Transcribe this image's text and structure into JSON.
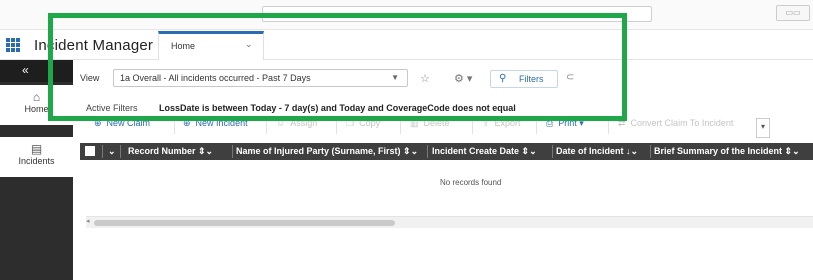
{
  "app": {
    "title": "Incident Manager"
  },
  "tabs": [
    {
      "label": "Home"
    }
  ],
  "sidebar": {
    "collapse_label": "«",
    "items": [
      {
        "label": "Home",
        "icon": "home-icon"
      },
      {
        "label": "Incidents",
        "icon": "document-icon"
      }
    ]
  },
  "view": {
    "label": "View",
    "selected": "1a Overall - All incidents occurred - Past 7 Days",
    "filters_label": "Filters"
  },
  "active_filters": {
    "label": "Active Filters",
    "value": "LossDate is between Today - 7 day(s) and Today and CoverageCode does not equal"
  },
  "toolbar": {
    "buttons": [
      {
        "label": "New Claim",
        "icon": "plus-circle-icon",
        "enabled": true
      },
      {
        "label": "New Incident",
        "icon": "plus-circle-icon",
        "enabled": true
      },
      {
        "label": "Assign",
        "icon": "user-icon",
        "enabled": false
      },
      {
        "label": "Copy",
        "icon": "copy-icon",
        "enabled": false
      },
      {
        "label": "Delete",
        "icon": "trash-icon",
        "enabled": false
      },
      {
        "label": "Export",
        "icon": "export-icon",
        "enabled": false
      },
      {
        "label": "Print",
        "icon": "print-icon",
        "enabled": true
      },
      {
        "label": "Convert Claim To Incident",
        "icon": "convert-icon",
        "enabled": false
      }
    ]
  },
  "table": {
    "columns": [
      "Record Number",
      "Name of Injured Party (Surname, First)",
      "Incident Create Date",
      "Date of Incident",
      "Brief Summary of the Incident"
    ],
    "empty_message": "No records found"
  },
  "colors": {
    "accent": "#2b6cb0",
    "highlight_frame": "#1fa84a",
    "sidebar_bg": "#2d2d2d",
    "header_bg": "#3f3f3f"
  }
}
